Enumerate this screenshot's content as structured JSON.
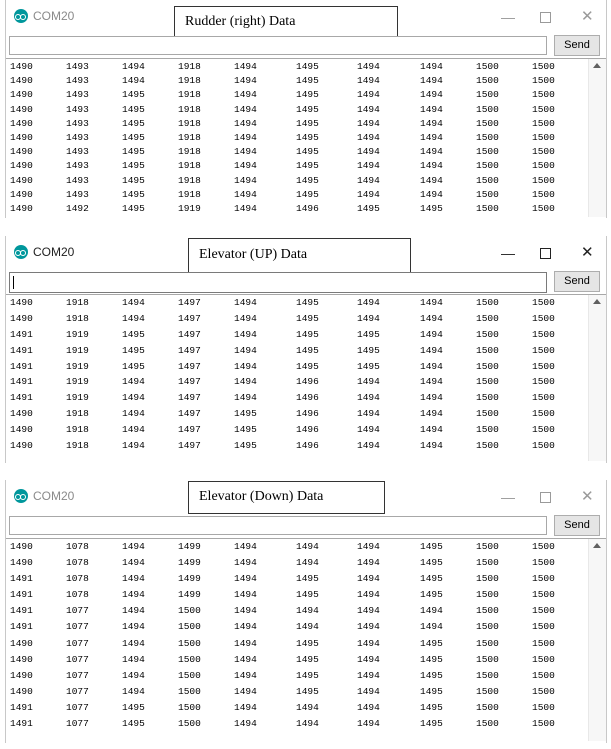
{
  "panels": [
    {
      "com_title": "COM20",
      "caption": "Rudder (right) Data",
      "send_label": "Send",
      "rows": [
        [
          "1490",
          "1493",
          "1494",
          "1918",
          "1494",
          "1495",
          "1494",
          "1494",
          "1500",
          "1500"
        ],
        [
          "1490",
          "1493",
          "1494",
          "1918",
          "1494",
          "1495",
          "1494",
          "1494",
          "1500",
          "1500"
        ],
        [
          "1490",
          "1493",
          "1495",
          "1918",
          "1494",
          "1495",
          "1494",
          "1494",
          "1500",
          "1500"
        ],
        [
          "1490",
          "1493",
          "1495",
          "1918",
          "1494",
          "1495",
          "1494",
          "1494",
          "1500",
          "1500"
        ],
        [
          "1490",
          "1493",
          "1495",
          "1918",
          "1494",
          "1495",
          "1494",
          "1494",
          "1500",
          "1500"
        ],
        [
          "1490",
          "1493",
          "1495",
          "1918",
          "1494",
          "1495",
          "1494",
          "1494",
          "1500",
          "1500"
        ],
        [
          "1490",
          "1493",
          "1495",
          "1918",
          "1494",
          "1495",
          "1494",
          "1494",
          "1500",
          "1500"
        ],
        [
          "1490",
          "1493",
          "1495",
          "1918",
          "1494",
          "1495",
          "1494",
          "1494",
          "1500",
          "1500"
        ],
        [
          "1490",
          "1493",
          "1495",
          "1918",
          "1494",
          "1495",
          "1494",
          "1494",
          "1500",
          "1500"
        ],
        [
          "1490",
          "1493",
          "1495",
          "1918",
          "1494",
          "1495",
          "1494",
          "1494",
          "1500",
          "1500"
        ],
        [
          "1490",
          "1492",
          "1495",
          "1919",
          "1494",
          "1496",
          "1495",
          "1495",
          "1500",
          "1500"
        ]
      ]
    },
    {
      "com_title": "COM20",
      "caption": "Elevator (UP) Data",
      "send_label": "Send",
      "rows": [
        [
          "1490",
          "1918",
          "1494",
          "1497",
          "1494",
          "1495",
          "1494",
          "1494",
          "1500",
          "1500"
        ],
        [
          "1490",
          "1918",
          "1494",
          "1497",
          "1494",
          "1495",
          "1494",
          "1494",
          "1500",
          "1500"
        ],
        [
          "1491",
          "1919",
          "1495",
          "1497",
          "1494",
          "1495",
          "1495",
          "1494",
          "1500",
          "1500"
        ],
        [
          "1491",
          "1919",
          "1495",
          "1497",
          "1494",
          "1495",
          "1495",
          "1494",
          "1500",
          "1500"
        ],
        [
          "1491",
          "1919",
          "1495",
          "1497",
          "1494",
          "1495",
          "1495",
          "1494",
          "1500",
          "1500"
        ],
        [
          "1491",
          "1919",
          "1494",
          "1497",
          "1494",
          "1496",
          "1494",
          "1494",
          "1500",
          "1500"
        ],
        [
          "1491",
          "1919",
          "1494",
          "1497",
          "1494",
          "1496",
          "1494",
          "1494",
          "1500",
          "1500"
        ],
        [
          "1490",
          "1918",
          "1494",
          "1497",
          "1495",
          "1496",
          "1494",
          "1494",
          "1500",
          "1500"
        ],
        [
          "1490",
          "1918",
          "1494",
          "1497",
          "1495",
          "1496",
          "1494",
          "1494",
          "1500",
          "1500"
        ],
        [
          "1490",
          "1918",
          "1494",
          "1497",
          "1495",
          "1496",
          "1494",
          "1494",
          "1500",
          "1500"
        ]
      ]
    },
    {
      "com_title": "COM20",
      "caption": "Elevator (Down) Data",
      "send_label": "Send",
      "rows": [
        [
          "1490",
          "1078",
          "1494",
          "1499",
          "1494",
          "1494",
          "1494",
          "1495",
          "1500",
          "1500"
        ],
        [
          "1490",
          "1078",
          "1494",
          "1499",
          "1494",
          "1494",
          "1494",
          "1495",
          "1500",
          "1500"
        ],
        [
          "1491",
          "1078",
          "1494",
          "1499",
          "1494",
          "1495",
          "1494",
          "1495",
          "1500",
          "1500"
        ],
        [
          "1491",
          "1078",
          "1494",
          "1499",
          "1494",
          "1495",
          "1494",
          "1495",
          "1500",
          "1500"
        ],
        [
          "1491",
          "1077",
          "1494",
          "1500",
          "1494",
          "1494",
          "1494",
          "1494",
          "1500",
          "1500"
        ],
        [
          "1491",
          "1077",
          "1494",
          "1500",
          "1494",
          "1494",
          "1494",
          "1494",
          "1500",
          "1500"
        ],
        [
          "1490",
          "1077",
          "1494",
          "1500",
          "1494",
          "1495",
          "1494",
          "1495",
          "1500",
          "1500"
        ],
        [
          "1490",
          "1077",
          "1494",
          "1500",
          "1494",
          "1495",
          "1494",
          "1495",
          "1500",
          "1500"
        ],
        [
          "1490",
          "1077",
          "1494",
          "1500",
          "1494",
          "1495",
          "1494",
          "1495",
          "1500",
          "1500"
        ],
        [
          "1490",
          "1077",
          "1494",
          "1500",
          "1494",
          "1495",
          "1494",
          "1495",
          "1500",
          "1500"
        ],
        [
          "1491",
          "1077",
          "1495",
          "1500",
          "1494",
          "1494",
          "1494",
          "1495",
          "1500",
          "1500"
        ],
        [
          "1491",
          "1077",
          "1495",
          "1500",
          "1494",
          "1494",
          "1494",
          "1495",
          "1500",
          "1500"
        ]
      ]
    }
  ],
  "accent_color": "#00979c",
  "icons": [
    "arduino-logo-icon",
    "minimize-icon",
    "maximize-icon",
    "close-icon",
    "scroll-up-arrow-icon"
  ]
}
